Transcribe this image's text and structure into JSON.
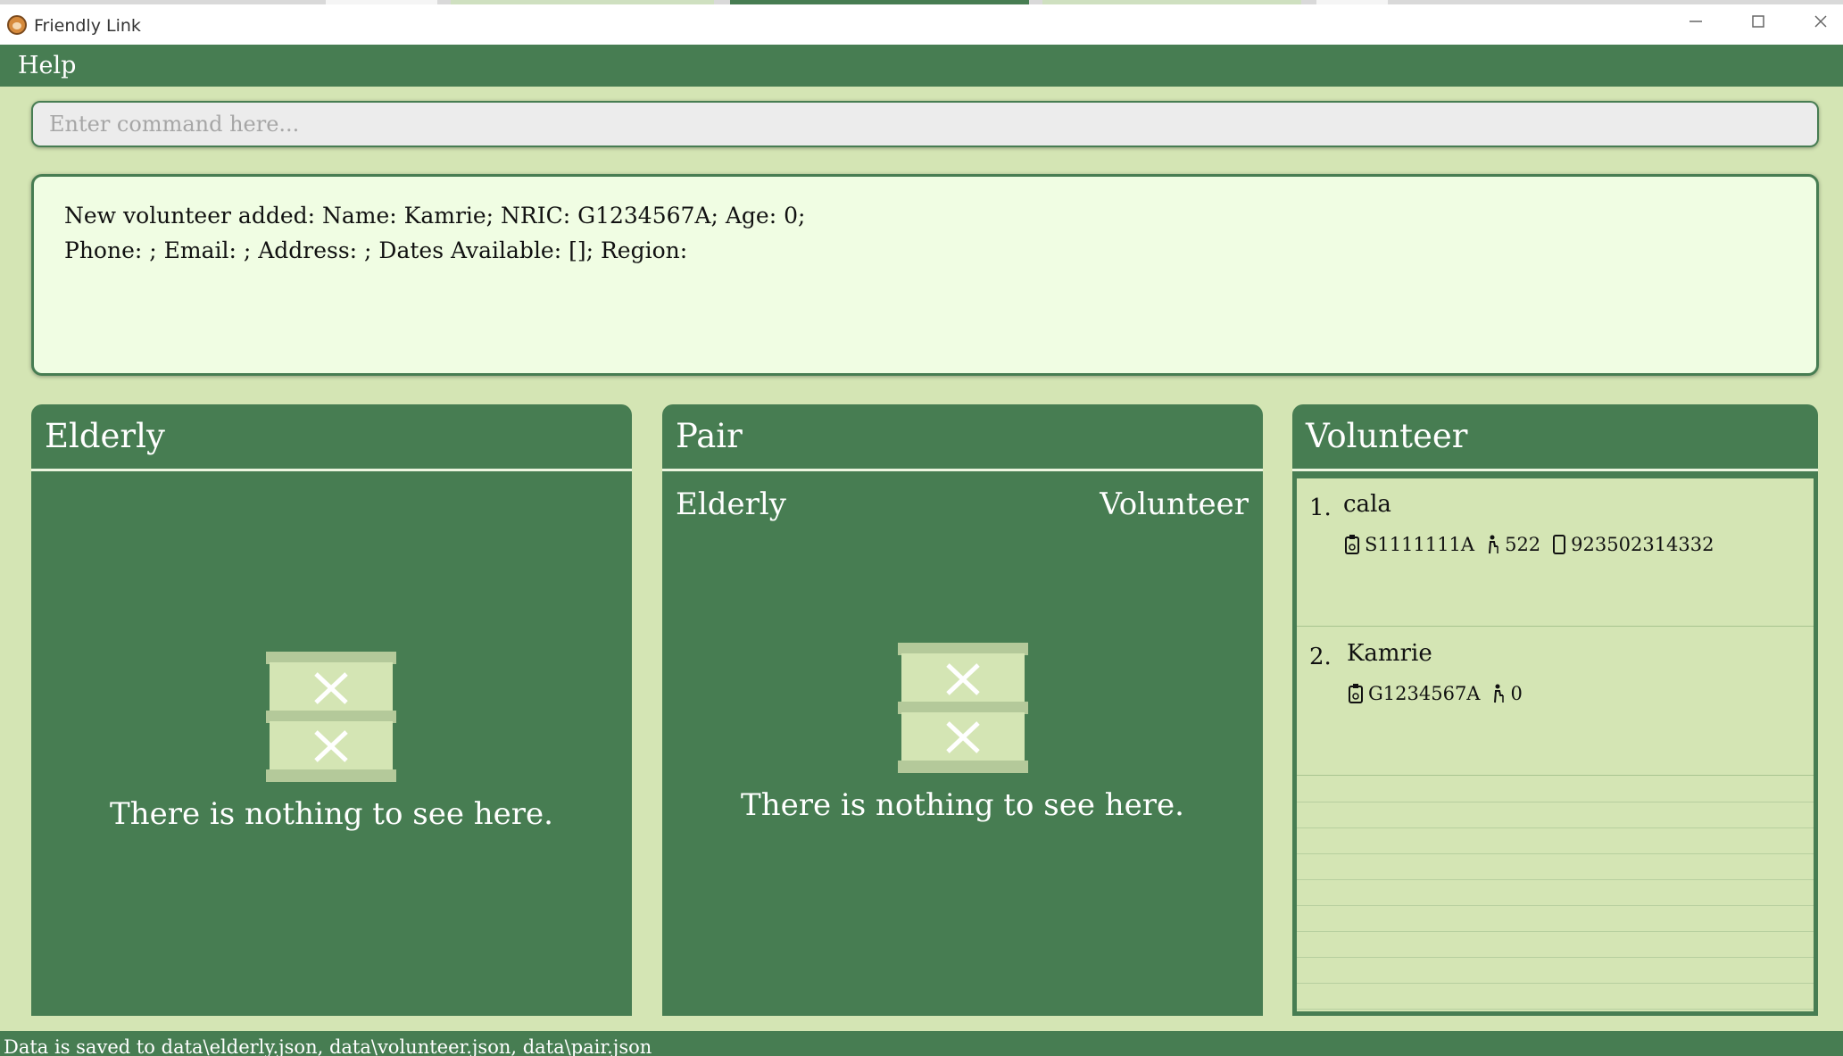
{
  "window": {
    "title": "Friendly Link",
    "controls": [
      "minimize-icon",
      "maximize-icon",
      "close-icon"
    ]
  },
  "menu": {
    "help_label": "Help"
  },
  "command": {
    "placeholder": "Enter command here...",
    "value": ""
  },
  "result": {
    "line1": "New volunteer added: Name: Kamrie; NRIC: G1234567A; Age: 0;",
    "line2": "Phone: ; Email: ; Address: ; Dates Available: []; Region:"
  },
  "panels": {
    "elderly": {
      "title": "Elderly",
      "empty_text": "There is nothing to see here."
    },
    "pair": {
      "title": "Pair",
      "col_elderly": "Elderly",
      "col_volunteer": "Volunteer",
      "empty_text": "There is nothing to see here."
    },
    "volunteer": {
      "title": "Volunteer",
      "items": [
        {
          "index": "1.",
          "name": "cala",
          "nric": "S1111111A",
          "age": "522",
          "phone": "923502314332"
        },
        {
          "index": "2.",
          "name": "Kamrie",
          "nric": "G1234567A",
          "age": "0",
          "phone": ""
        }
      ]
    }
  },
  "status": {
    "text": "Data is saved to data\\elderly.json, data\\volunteer.json, data\\pair.json"
  },
  "colors": {
    "primary": "#477d52",
    "background": "#d4e5b4",
    "result_bg": "#f0fde3",
    "text_light": "#ffffff"
  }
}
